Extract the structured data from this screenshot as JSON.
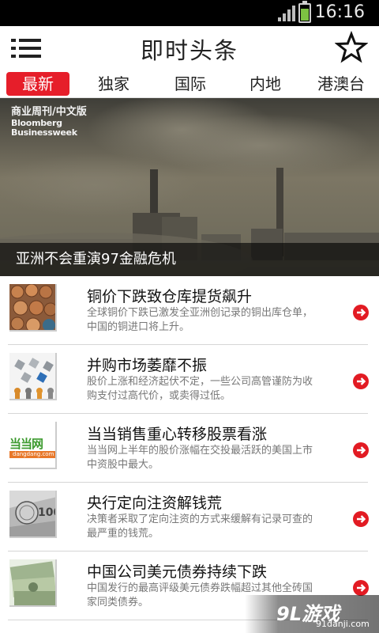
{
  "status_bar": {
    "time": "16:16"
  },
  "header": {
    "title": "即时头条"
  },
  "tabs": [
    {
      "label": "最新",
      "active": true
    },
    {
      "label": "独家",
      "active": false
    },
    {
      "label": "国际",
      "active": false
    },
    {
      "label": "内地",
      "active": false
    },
    {
      "label": "港澳台",
      "active": false
    }
  ],
  "hero": {
    "logo_cn": "商业周刊/中文版",
    "logo_en_1": "Bloomberg",
    "logo_en_2": "Businessweek",
    "caption": "亚洲不会重演97金融危机"
  },
  "news": [
    {
      "title": "铜价下跌致仓库提货飙升",
      "summary": "全球铜价下跌已激发全亚洲创记录的铜出库仓单，中国的铜进口将上升。"
    },
    {
      "title": "并购市场萎靡不振",
      "summary": "股价上涨和经济起伏不定，一些公司高管谨防为收购支付过高代价，或卖得过低。"
    },
    {
      "title": "当当销售重心转移股票看涨",
      "summary": "当当网上半年的股价涨幅在交投最活跃的美国上市中资股中最大。",
      "thumb_text": "当当网",
      "thumb_sub": "dangdang.com"
    },
    {
      "title": "央行定向注资解钱荒",
      "summary": "决策者采取了定向注资的方式来缓解有记录可查的最严重的钱荒。"
    },
    {
      "title": "中国公司美元债券持续下跌",
      "summary": "中国发行的最高评级美元债券跌幅超过其他全砖国家同类债券。"
    }
  ],
  "watermark": {
    "logo": "9L游戏",
    "site": "91danji.com"
  },
  "colors": {
    "accent": "#e61e2a",
    "title_text": "#222222",
    "summary_text": "#777777"
  },
  "icons": {
    "menu": "list-icon",
    "favorite": "star-icon",
    "item_action": "arrow-right-circle-icon"
  }
}
